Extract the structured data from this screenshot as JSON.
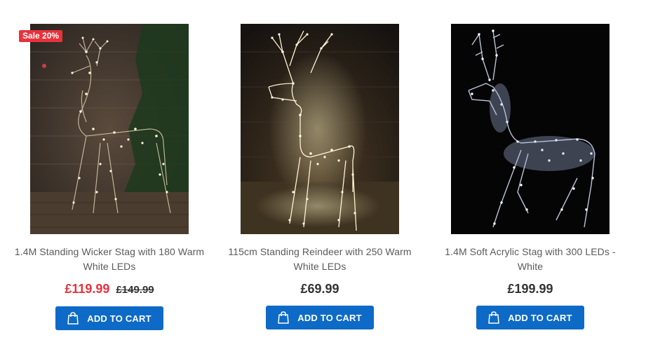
{
  "products": [
    {
      "badge": "Sale 20%",
      "title": "1.4M Standing Wicker Stag with 180 Warm White LEDs",
      "price": "£119.99",
      "old_price": "£149.99",
      "button_label": "ADD TO CART",
      "image_icon": "reindeer-light-image"
    },
    {
      "title": "115cm Standing Reindeer with 250 Warm White LEDs",
      "price": "£69.99",
      "button_label": "ADD TO CART",
      "image_icon": "reindeer-light-image"
    },
    {
      "title": "1.4M Soft Acrylic Stag with 300 LEDs - White",
      "price": "£199.99",
      "button_label": "ADD TO CART",
      "image_icon": "stag-light-image"
    }
  ],
  "colors": {
    "sale_red": "#e8323c",
    "button_blue": "#0e6ac7",
    "title_grey": "#5a5a5a"
  },
  "icons": {
    "cart": "shopping-bag-icon"
  }
}
